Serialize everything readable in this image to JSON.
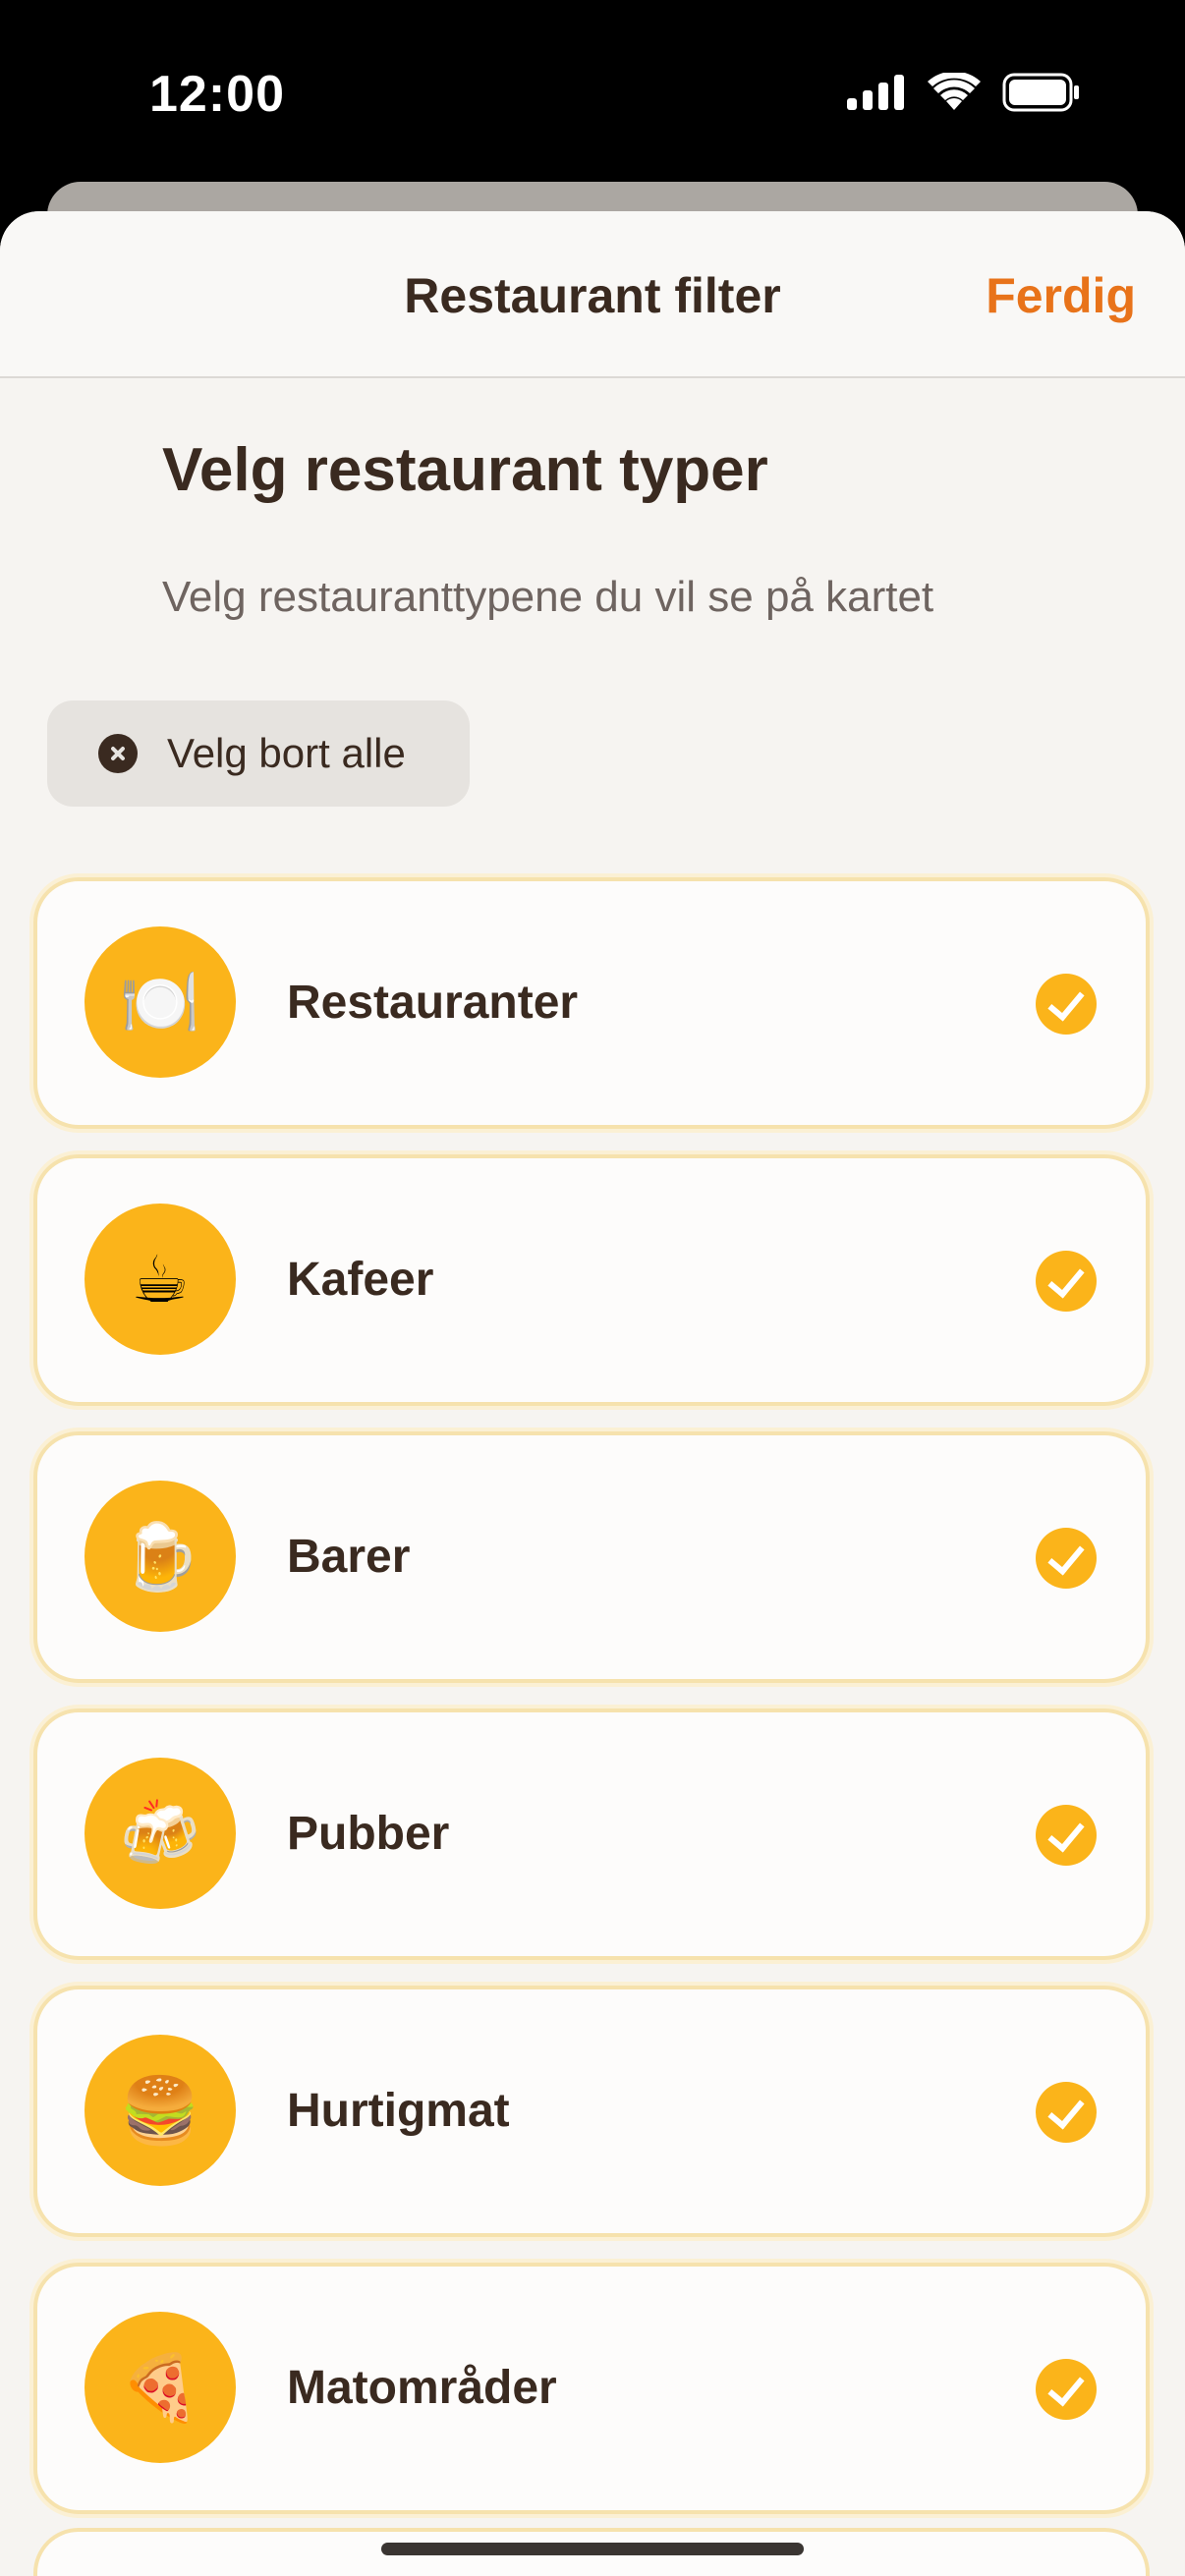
{
  "status_bar": {
    "time": "12:00",
    "icons": [
      "signal-icon",
      "wifi-icon",
      "battery-icon"
    ]
  },
  "nav": {
    "title": "Restaurant filter",
    "done_label": "Ferdig"
  },
  "section": {
    "title": "Velg restaurant typer",
    "subtitle": "Velg restauranttypene du vil se på kartet"
  },
  "deselect": {
    "label": "Velg bort alle",
    "icon": "close-circle-icon"
  },
  "categories": [
    {
      "label": "Restauranter",
      "emoji": "🍽️",
      "icon": "plate-cutlery-icon",
      "selected": true
    },
    {
      "label": "Kafeer",
      "emoji": "☕",
      "icon": "coffee-cup-icon",
      "selected": true
    },
    {
      "label": "Barer",
      "emoji": "🍺",
      "icon": "beer-mug-icon",
      "selected": true
    },
    {
      "label": "Pubber",
      "emoji": "🍻",
      "icon": "clinking-beers-icon",
      "selected": true
    },
    {
      "label": "Hurtigmat",
      "emoji": "🍔",
      "icon": "burger-icon",
      "selected": true
    },
    {
      "label": "Matområder",
      "emoji": "🍕",
      "icon": "pizza-icon",
      "selected": true
    }
  ],
  "colors": {
    "accent": "#e8731a",
    "icon_bg": "#fbb41a",
    "text": "#3a2a20",
    "sheet_bg": "#f6f4f1",
    "row_border": "#f6e2ad"
  }
}
